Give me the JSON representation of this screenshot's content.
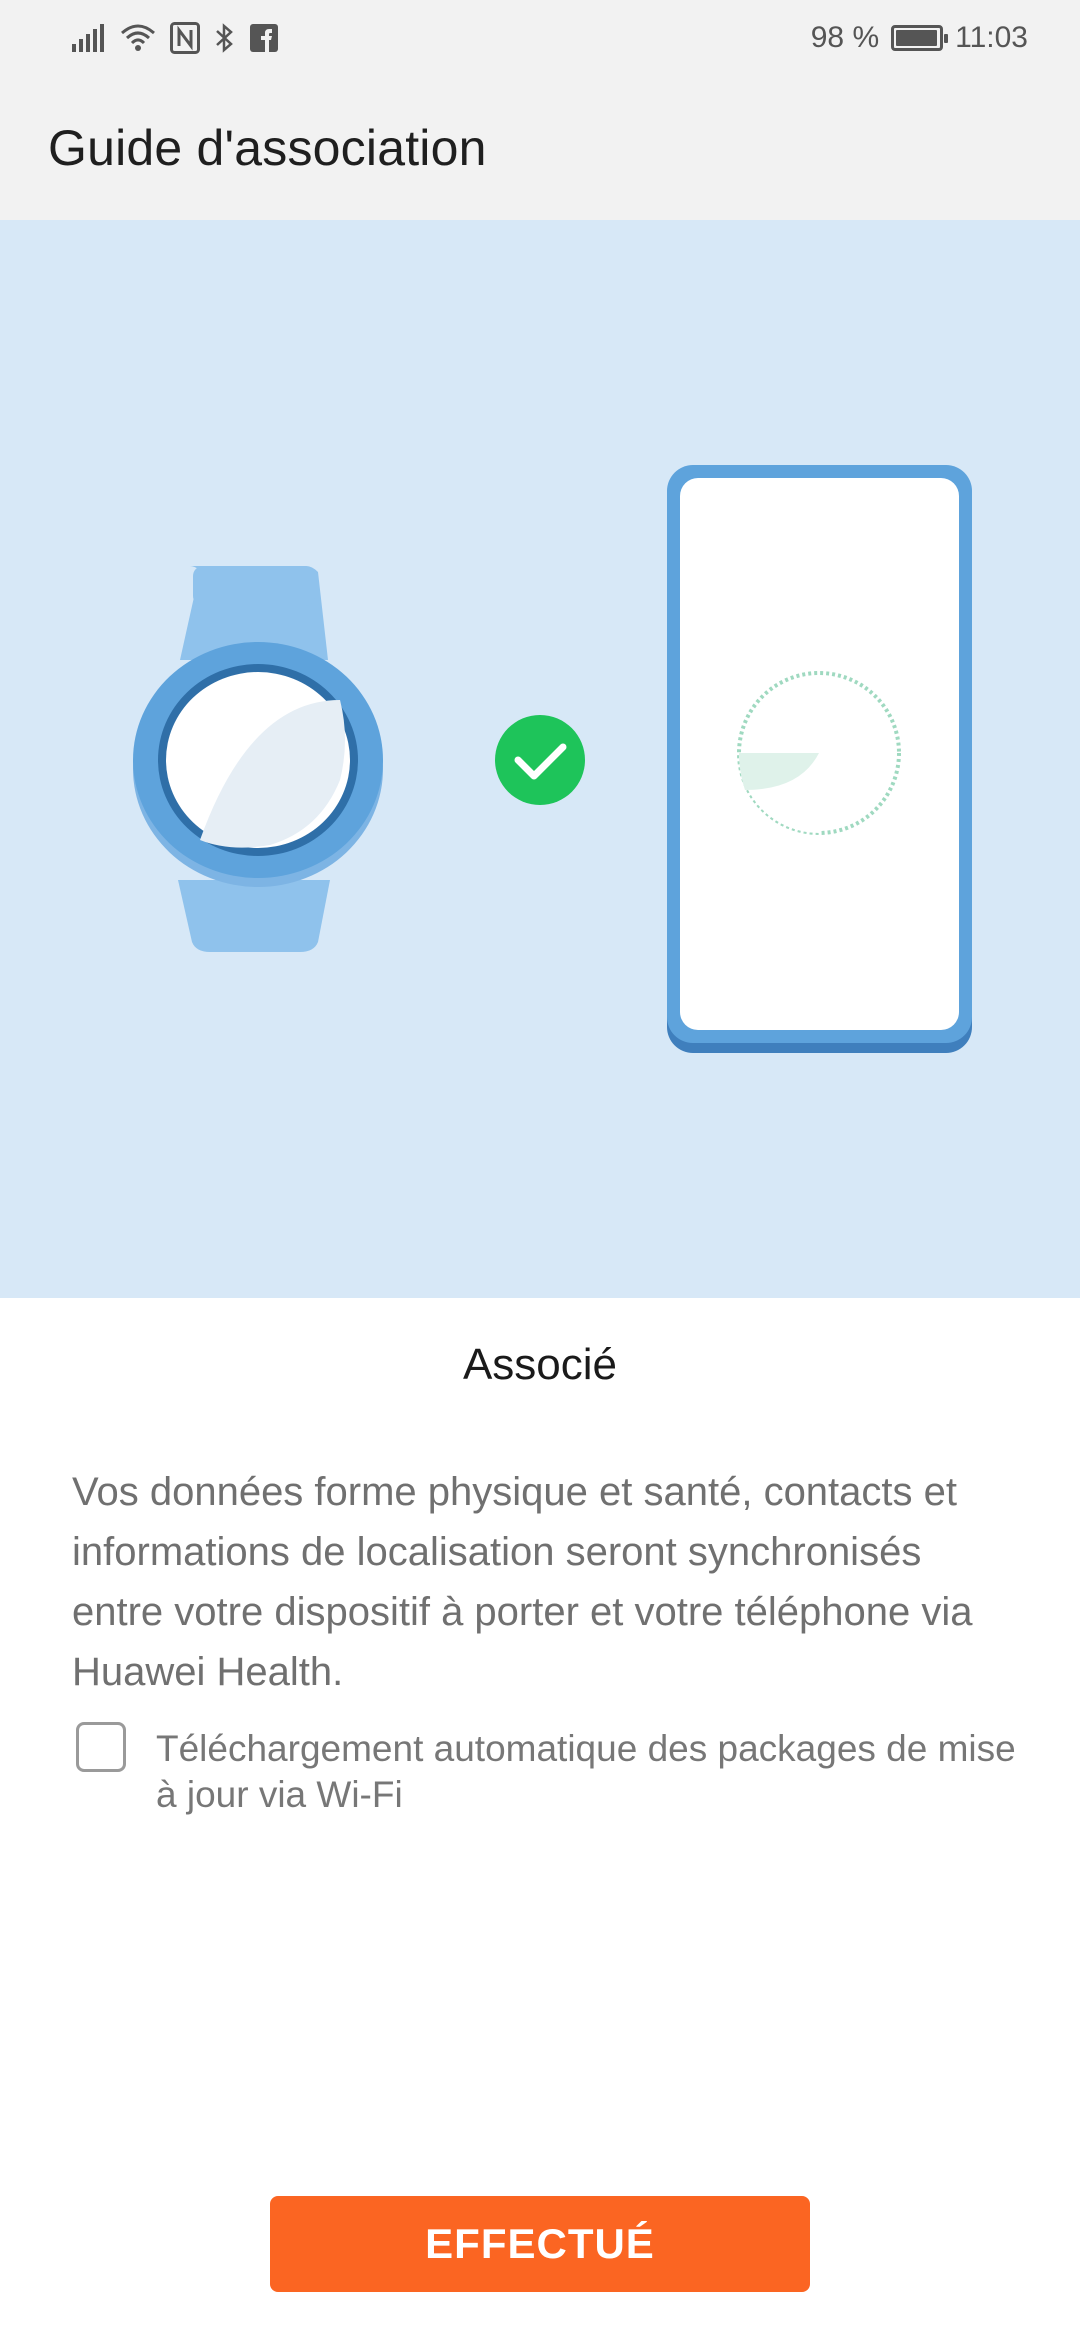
{
  "status_bar": {
    "battery_text": "98 %",
    "battery_level": 0.98,
    "time": "11:03",
    "icons": [
      "signal-icon",
      "wifi-icon",
      "nfc-icon",
      "bluetooth-icon",
      "facebook-icon"
    ]
  },
  "header": {
    "title": "Guide d'association"
  },
  "illustration": {
    "background_color": "#d7e8f7",
    "watch_color": "#8fc2ec",
    "phone_frame_color": "#5ea3dc",
    "check_color": "#1ec45a",
    "icons": [
      "watch-icon",
      "check-icon",
      "phone-icon"
    ]
  },
  "pairing": {
    "status_label": "Associé",
    "description": "Vos données forme physique et santé, contacts et informations de localisation seront synchronisés entre votre dispositif à porter et votre téléphone via Huawei Health.",
    "auto_update_label": "Téléchargement automatique des packages de mise à jour via Wi-Fi",
    "auto_update_checked": false
  },
  "footer": {
    "done_label": "EFFECTUÉ",
    "accent_color": "#fb6522"
  }
}
